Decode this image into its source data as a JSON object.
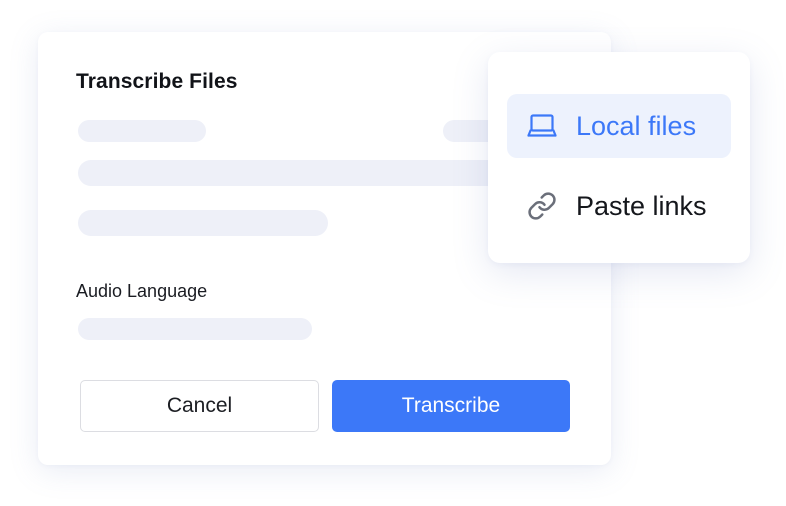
{
  "dialog": {
    "title": "Transcribe Files",
    "audio_language_label": "Audio Language",
    "cancel_label": "Cancel",
    "submit_label": "Transcribe"
  },
  "menu": {
    "items": [
      {
        "label": "Local files",
        "icon": "laptop-icon",
        "active": true
      },
      {
        "label": "Paste links",
        "icon": "link-icon",
        "active": false
      }
    ]
  },
  "colors": {
    "accent": "#3c78f8",
    "skeleton": "#eef0f8",
    "menu_active_bg": "#edf2fd"
  }
}
